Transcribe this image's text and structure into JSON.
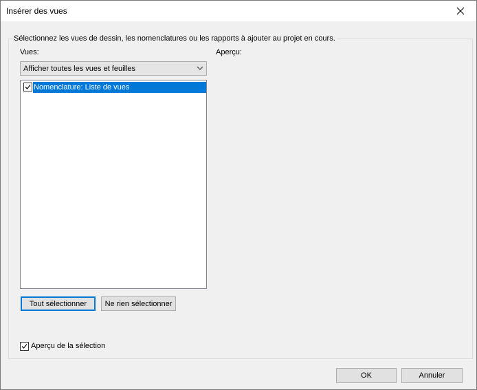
{
  "window": {
    "title": "Insérer des vues"
  },
  "group": {
    "caption": "Sélectionnez les vues de dessin, les nomenclatures ou les rapports à ajouter au projet en cours."
  },
  "views": {
    "label": "Vues:",
    "filter_selected": "Afficher toutes les vues et feuilles",
    "items": [
      {
        "label": "Nomenclature: Liste de vues",
        "checked": true,
        "selected": true
      }
    ]
  },
  "preview": {
    "label": "Aperçu:"
  },
  "buttons": {
    "select_all": "Tout sélectionner",
    "select_none": "Ne rien sélectionner",
    "ok": "OK",
    "cancel": "Annuler"
  },
  "preview_selection": {
    "label": "Aperçu de la sélection",
    "checked": true
  },
  "colors": {
    "selection": "#0078d7",
    "dialog_bg": "#f0f0f0"
  },
  "icons": [
    "close-icon",
    "chevron-down-icon",
    "checkbox-checked-icon"
  ]
}
